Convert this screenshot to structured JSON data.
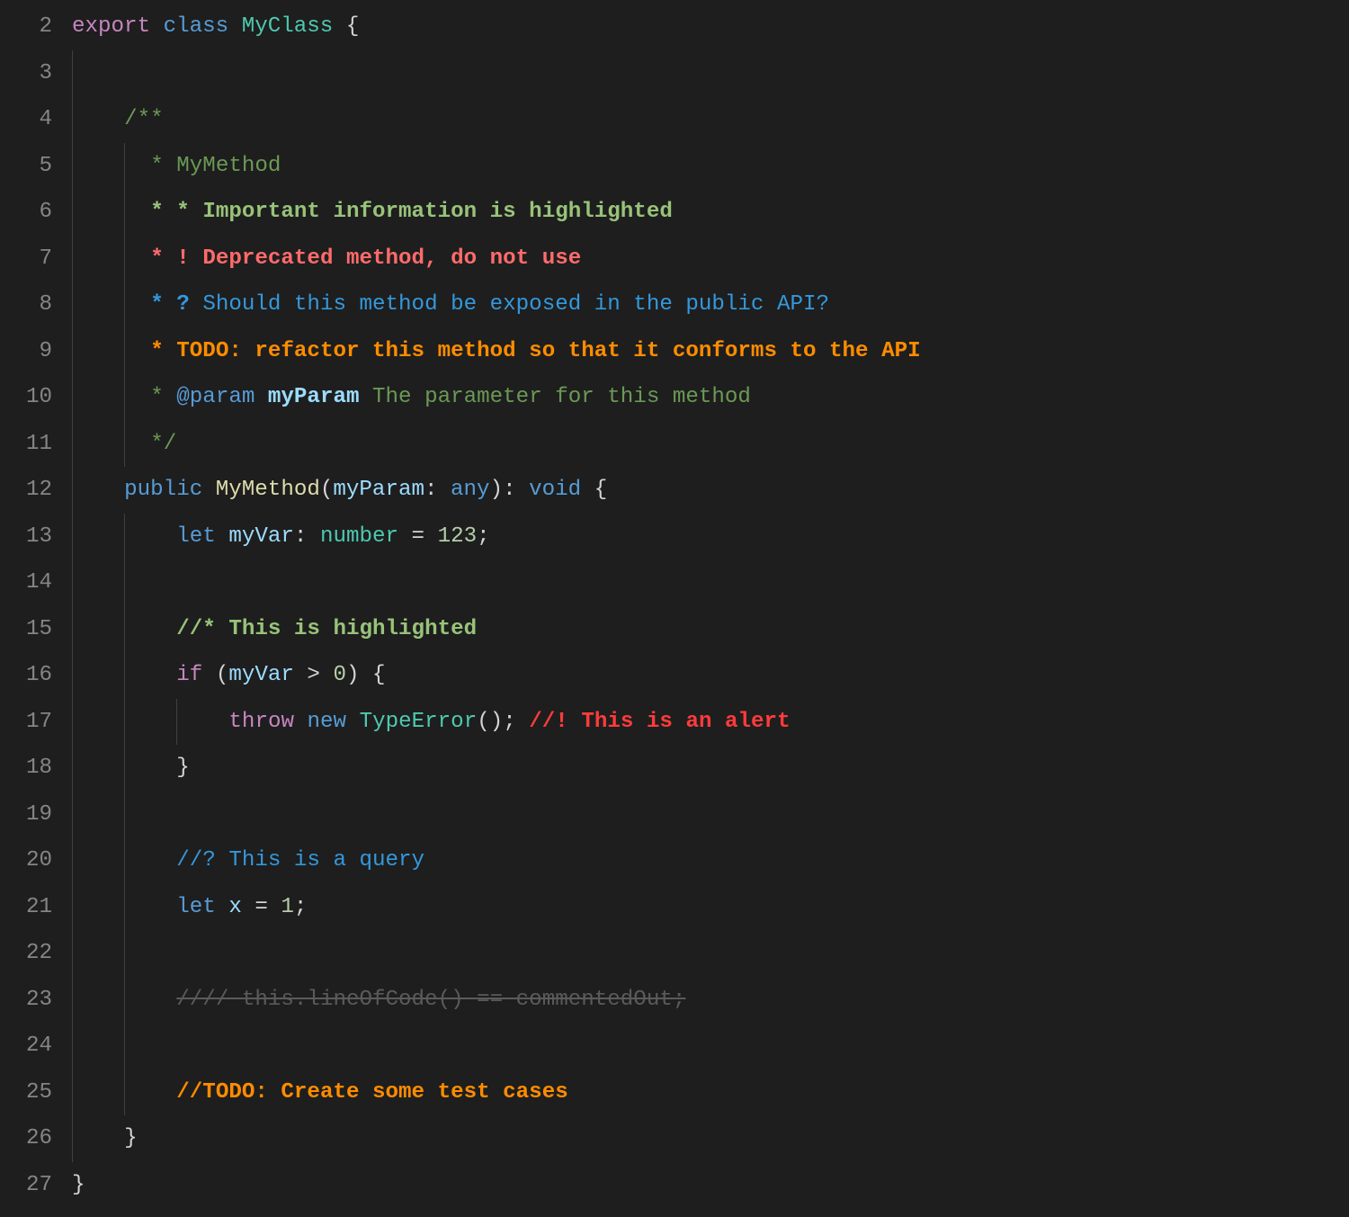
{
  "editor": {
    "startLine": 2,
    "endLine": 27,
    "lines": {
      "2": [
        {
          "pad": 0,
          "guide": false
        },
        {
          "t": "export",
          "c": "tok-keyword"
        },
        {
          "t": " "
        },
        {
          "t": "class",
          "c": "tok-storage"
        },
        {
          "t": " "
        },
        {
          "t": "MyClass",
          "c": "tok-class"
        },
        {
          "t": " "
        },
        {
          "t": "{",
          "c": "tok-punct"
        }
      ],
      "3": [
        {
          "pad": 0,
          "guide": true
        }
      ],
      "4": [
        {
          "pad": 0,
          "guide": true
        },
        {
          "pad": 3
        },
        {
          "t": "/**",
          "c": "tok-doc"
        }
      ],
      "5": [
        {
          "pad": 0,
          "guide": true
        },
        {
          "pad": 3
        },
        {
          "pad": 0,
          "guide": true
        },
        {
          "t": " * ",
          "c": "tok-doc-star"
        },
        {
          "t": "MyMethod",
          "c": "tok-doc"
        }
      ],
      "6": [
        {
          "pad": 0,
          "guide": true
        },
        {
          "pad": 3
        },
        {
          "pad": 0,
          "guide": true
        },
        {
          "t": " ",
          "c": "tok-doc-star"
        },
        {
          "t": "* * ",
          "c": "tok-doc-hi-star"
        },
        {
          "t": "Important information is highlighted",
          "c": "tok-doc-hi"
        }
      ],
      "7": [
        {
          "pad": 0,
          "guide": true
        },
        {
          "pad": 3
        },
        {
          "pad": 0,
          "guide": true
        },
        {
          "t": " ",
          "c": "tok-doc-star"
        },
        {
          "t": "* ! ",
          "c": "tok-doc-alert-star"
        },
        {
          "t": "Deprecated method, do not use",
          "c": "tok-doc-alert"
        }
      ],
      "8": [
        {
          "pad": 0,
          "guide": true
        },
        {
          "pad": 3
        },
        {
          "pad": 0,
          "guide": true
        },
        {
          "t": " ",
          "c": "tok-doc-star"
        },
        {
          "t": "* ? ",
          "c": "tok-doc-query-star"
        },
        {
          "t": "Should this method be exposed in the public API?",
          "c": "tok-doc-query"
        }
      ],
      "9": [
        {
          "pad": 0,
          "guide": true
        },
        {
          "pad": 3
        },
        {
          "pad": 0,
          "guide": true
        },
        {
          "t": " ",
          "c": "tok-doc-star"
        },
        {
          "t": "* ",
          "c": "tok-doc-todo-star"
        },
        {
          "t": "TODO: refactor this method so that it conforms to the API",
          "c": "tok-doc-todo"
        }
      ],
      "10": [
        {
          "pad": 0,
          "guide": true
        },
        {
          "pad": 3
        },
        {
          "pad": 0,
          "guide": true
        },
        {
          "t": " * ",
          "c": "tok-doc-star"
        },
        {
          "t": "@param",
          "c": "tok-doc-tag"
        },
        {
          "t": " "
        },
        {
          "t": "myParam",
          "c": "tok-doc-param"
        },
        {
          "t": " The parameter for this method",
          "c": "tok-doc"
        }
      ],
      "11": [
        {
          "pad": 0,
          "guide": true
        },
        {
          "pad": 3
        },
        {
          "pad": 0,
          "guide": true
        },
        {
          "t": " */",
          "c": "tok-doc"
        }
      ],
      "12": [
        {
          "pad": 0,
          "guide": true
        },
        {
          "pad": 3
        },
        {
          "t": "public",
          "c": "tok-storage"
        },
        {
          "t": " "
        },
        {
          "t": "MyMethod",
          "c": "tok-method"
        },
        {
          "t": "(",
          "c": "tok-punct"
        },
        {
          "t": "myParam",
          "c": "tok-var"
        },
        {
          "t": ": ",
          "c": "tok-punct"
        },
        {
          "t": "any",
          "c": "tok-storage"
        },
        {
          "t": ")",
          "c": "tok-punct"
        },
        {
          "t": ": ",
          "c": "tok-punct"
        },
        {
          "t": "void",
          "c": "tok-storage"
        },
        {
          "t": " "
        },
        {
          "t": "{",
          "c": "tok-punct"
        }
      ],
      "13": [
        {
          "pad": 0,
          "guide": true
        },
        {
          "pad": 3
        },
        {
          "pad": 0,
          "guide": true
        },
        {
          "pad": 3
        },
        {
          "t": "let",
          "c": "tok-storage"
        },
        {
          "t": " "
        },
        {
          "t": "myVar",
          "c": "tok-var"
        },
        {
          "t": ": ",
          "c": "tok-punct"
        },
        {
          "t": "number",
          "c": "tok-type"
        },
        {
          "t": " = ",
          "c": "tok-punct"
        },
        {
          "t": "123",
          "c": "tok-number"
        },
        {
          "t": ";",
          "c": "tok-punct"
        }
      ],
      "14": [
        {
          "pad": 0,
          "guide": true
        },
        {
          "pad": 3
        },
        {
          "pad": 0,
          "guide": true
        }
      ],
      "15": [
        {
          "pad": 0,
          "guide": true
        },
        {
          "pad": 3
        },
        {
          "pad": 0,
          "guide": true
        },
        {
          "pad": 3
        },
        {
          "t": "//* This is highlighted",
          "c": "tok-c-hi"
        }
      ],
      "16": [
        {
          "pad": 0,
          "guide": true
        },
        {
          "pad": 3
        },
        {
          "pad": 0,
          "guide": true
        },
        {
          "pad": 3
        },
        {
          "t": "if",
          "c": "tok-keyword"
        },
        {
          "t": " (",
          "c": "tok-punct"
        },
        {
          "t": "myVar",
          "c": "tok-var"
        },
        {
          "t": " > ",
          "c": "tok-punct"
        },
        {
          "t": "0",
          "c": "tok-number"
        },
        {
          "t": ") {",
          "c": "tok-punct"
        }
      ],
      "17": [
        {
          "pad": 0,
          "guide": true
        },
        {
          "pad": 3
        },
        {
          "pad": 0,
          "guide": true
        },
        {
          "pad": 3
        },
        {
          "pad": 0,
          "guide": true
        },
        {
          "pad": 3
        },
        {
          "t": "throw",
          "c": "tok-keyword"
        },
        {
          "t": " "
        },
        {
          "t": "new",
          "c": "tok-storage"
        },
        {
          "t": " "
        },
        {
          "t": "TypeError",
          "c": "tok-type"
        },
        {
          "t": "();",
          "c": "tok-punct"
        },
        {
          "t": " "
        },
        {
          "t": "//! This is an alert",
          "c": "tok-c-alert"
        }
      ],
      "18": [
        {
          "pad": 0,
          "guide": true
        },
        {
          "pad": 3
        },
        {
          "pad": 0,
          "guide": true
        },
        {
          "pad": 3
        },
        {
          "t": "}",
          "c": "tok-punct"
        }
      ],
      "19": [
        {
          "pad": 0,
          "guide": true
        },
        {
          "pad": 3
        },
        {
          "pad": 0,
          "guide": true
        }
      ],
      "20": [
        {
          "pad": 0,
          "guide": true
        },
        {
          "pad": 3
        },
        {
          "pad": 0,
          "guide": true
        },
        {
          "pad": 3
        },
        {
          "t": "//? This is a query",
          "c": "tok-c-query"
        }
      ],
      "21": [
        {
          "pad": 0,
          "guide": true
        },
        {
          "pad": 3
        },
        {
          "pad": 0,
          "guide": true
        },
        {
          "pad": 3
        },
        {
          "t": "let",
          "c": "tok-storage"
        },
        {
          "t": " "
        },
        {
          "t": "x",
          "c": "tok-var"
        },
        {
          "t": " = ",
          "c": "tok-punct"
        },
        {
          "t": "1",
          "c": "tok-number"
        },
        {
          "t": ";",
          "c": "tok-punct"
        }
      ],
      "22": [
        {
          "pad": 0,
          "guide": true
        },
        {
          "pad": 3
        },
        {
          "pad": 0,
          "guide": true
        }
      ],
      "23": [
        {
          "pad": 0,
          "guide": true
        },
        {
          "pad": 3
        },
        {
          "pad": 0,
          "guide": true
        },
        {
          "pad": 3
        },
        {
          "t": "//// this.lineOfCode() == commentedOut;",
          "c": "tok-c-strike"
        }
      ],
      "24": [
        {
          "pad": 0,
          "guide": true
        },
        {
          "pad": 3
        },
        {
          "pad": 0,
          "guide": true
        }
      ],
      "25": [
        {
          "pad": 0,
          "guide": true
        },
        {
          "pad": 3
        },
        {
          "pad": 0,
          "guide": true
        },
        {
          "pad": 3
        },
        {
          "t": "//TODO: Create some test cases",
          "c": "tok-c-todo"
        }
      ],
      "26": [
        {
          "pad": 0,
          "guide": true
        },
        {
          "pad": 3
        },
        {
          "t": "}",
          "c": "tok-punct"
        }
      ],
      "27": [
        {
          "pad": 0
        },
        {
          "t": "}",
          "c": "tok-punct"
        }
      ]
    }
  }
}
